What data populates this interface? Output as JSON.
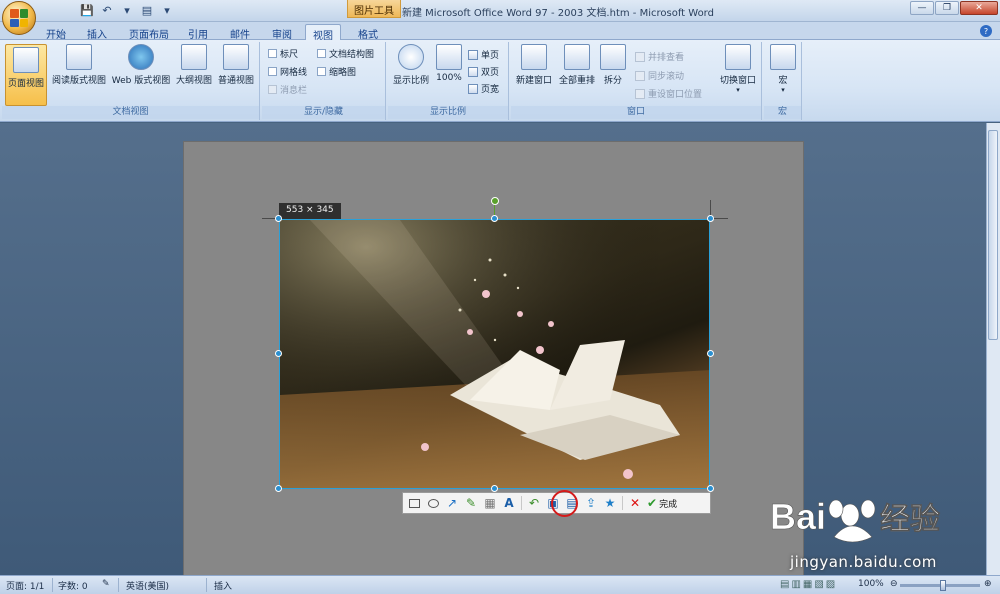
{
  "window": {
    "context_tab": "图片工具",
    "title": "新建 Microsoft Office Word 97 - 2003 文档.htm - Microsoft Word"
  },
  "tabs": [
    {
      "label": "开始"
    },
    {
      "label": "插入"
    },
    {
      "label": "页面布局"
    },
    {
      "label": "引用"
    },
    {
      "label": "邮件"
    },
    {
      "label": "审阅"
    },
    {
      "label": "视图",
      "active": true
    },
    {
      "label": "格式"
    }
  ],
  "ribbon": {
    "doc_views": {
      "label": "文档视图",
      "buttons": [
        "页面视图",
        "阅读版式视图",
        "Web 版式视图",
        "大纲视图",
        "普通视图"
      ]
    },
    "show_hide": {
      "label": "显示/隐藏",
      "items": [
        "标尺",
        "网格线",
        "消息栏",
        "文档结构图",
        "缩略图"
      ]
    },
    "zoom": {
      "label": "显示比例",
      "buttons": [
        "显示比例",
        "100%"
      ],
      "small": [
        "单页",
        "双页",
        "页宽"
      ]
    },
    "window": {
      "label": "窗口",
      "buttons": [
        "新建窗口",
        "全部重排",
        "拆分",
        "切换窗口"
      ],
      "small": [
        "并排查看",
        "同步滚动",
        "重设窗口位置"
      ]
    },
    "macro": {
      "label": "宏",
      "buttons": [
        "宏"
      ]
    }
  },
  "image": {
    "size_label": "553 × 345"
  },
  "screenshot_toolbar": {
    "done_label": "完成",
    "icons": [
      "rectangle",
      "ellipse",
      "arrow",
      "pen",
      "mosaic",
      "text",
      "undo",
      "save",
      "copy",
      "share",
      "pin",
      "cancel"
    ]
  },
  "statusbar": {
    "page": "页面: 1/1",
    "words": "字数: 0",
    "language": "英语(美国)",
    "mode": "插入",
    "zoom": "100%"
  },
  "watermark": {
    "brand": "Bai",
    "brand_cn": "经验",
    "url": "jingyan.baidu.com"
  },
  "colors": {
    "ribbon_bg": "#dbe7f5",
    "doc_bg": "#4e6a88",
    "selection": "#2aa0d8",
    "highlight_ring": "#d41a1a"
  }
}
